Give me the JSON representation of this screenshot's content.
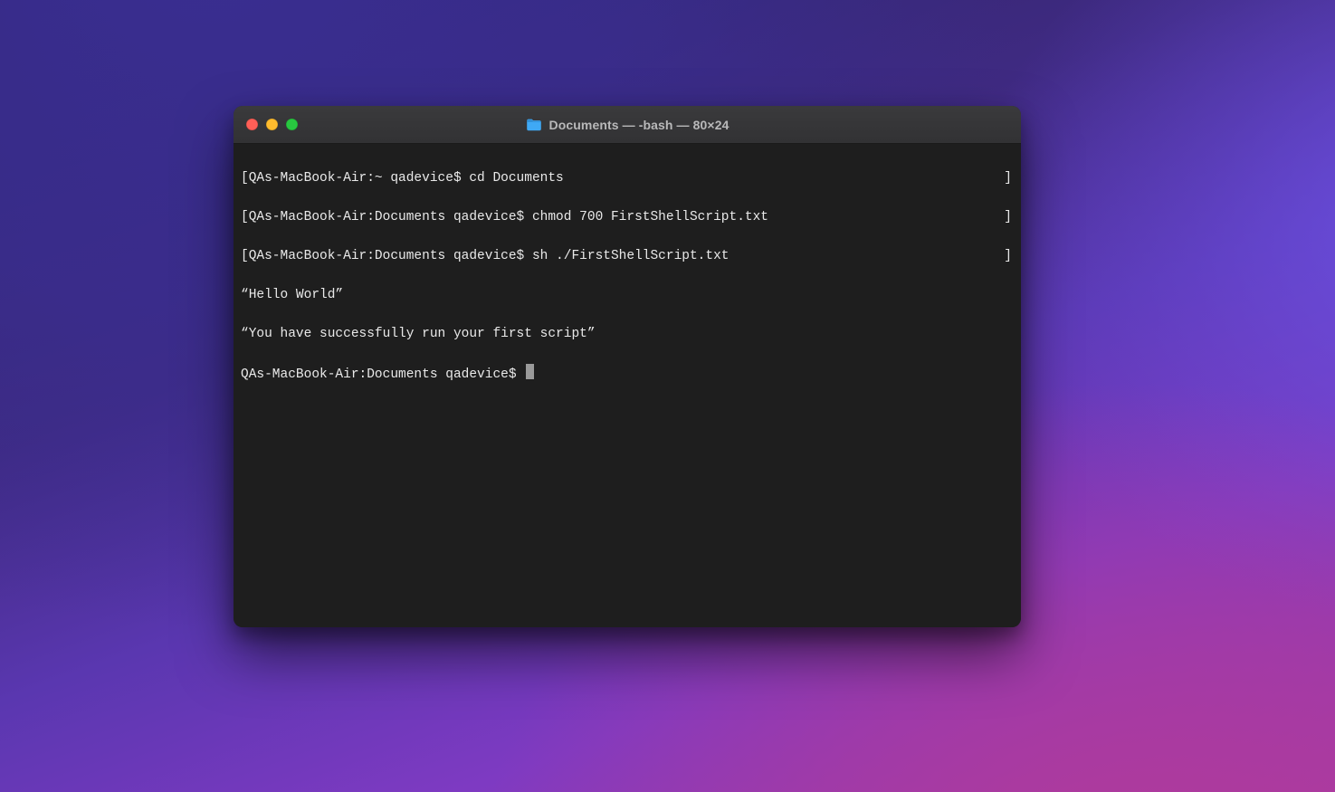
{
  "window": {
    "title": "Documents — -bash — 80×24"
  },
  "traffic_lights": {
    "close": "close",
    "minimize": "minimize",
    "zoom": "zoom"
  },
  "terminal": {
    "lines": [
      "QAs-MacBook-Air:~ qadevice$ cd Documents",
      "QAs-MacBook-Air:Documents qadevice$ chmod 700 FirstShellScript.txt",
      "QAs-MacBook-Air:Documents qadevice$ sh ./FirstShellScript.txt",
      "“Hello World”",
      "“You have successfully run your first script”"
    ],
    "prompt": "QAs-MacBook-Air:Documents qadevice$ "
  }
}
